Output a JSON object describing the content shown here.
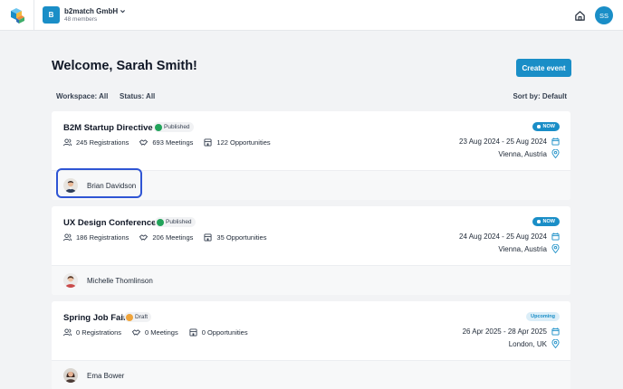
{
  "header": {
    "workspace_initial": "B",
    "workspace_name": "b2match GmbH",
    "workspace_members": "48 members",
    "user_initials": "SS"
  },
  "main": {
    "welcome": "Welcome, Sarah Smith!",
    "create_event_label": "Create event",
    "filters": {
      "workspace": "Workspace: All",
      "status": "Status: All",
      "sort": "Sort by: Default"
    }
  },
  "events": [
    {
      "title": "B2M Startup Directive",
      "status": "Published",
      "registrations": "245 Registrations",
      "meetings": "693 Meetings",
      "opportunities": "122 Opportunities",
      "badge": "NOW",
      "dates": "23 Aug 2024 - 25 Aug 2024",
      "location": "Vienna, Austria",
      "person": "Brian Davidson"
    },
    {
      "title": "UX Design Conference",
      "status": "Published",
      "registrations": "186 Registrations",
      "meetings": "206 Meetings",
      "opportunities": "35 Opportunities",
      "badge": "NOW",
      "dates": "24 Aug 2024 - 25 Aug 2024",
      "location": "Vienna, Austria",
      "person": "Michelle Thomlinson"
    },
    {
      "title": "Spring Job Fair",
      "status": "Draft",
      "registrations": "0 Registrations",
      "meetings": "0 Meetings",
      "opportunities": "0 Opportunities",
      "badge": "Upcoming",
      "dates": "26 Apr 2025 - 28 Apr 2025",
      "location": "London, UK",
      "person": "Ema Bower"
    }
  ],
  "colors": {
    "primary": "#1a8ec7",
    "published": "#22a35a",
    "draft": "#f0a43a",
    "highlight": "#2f55d4"
  }
}
